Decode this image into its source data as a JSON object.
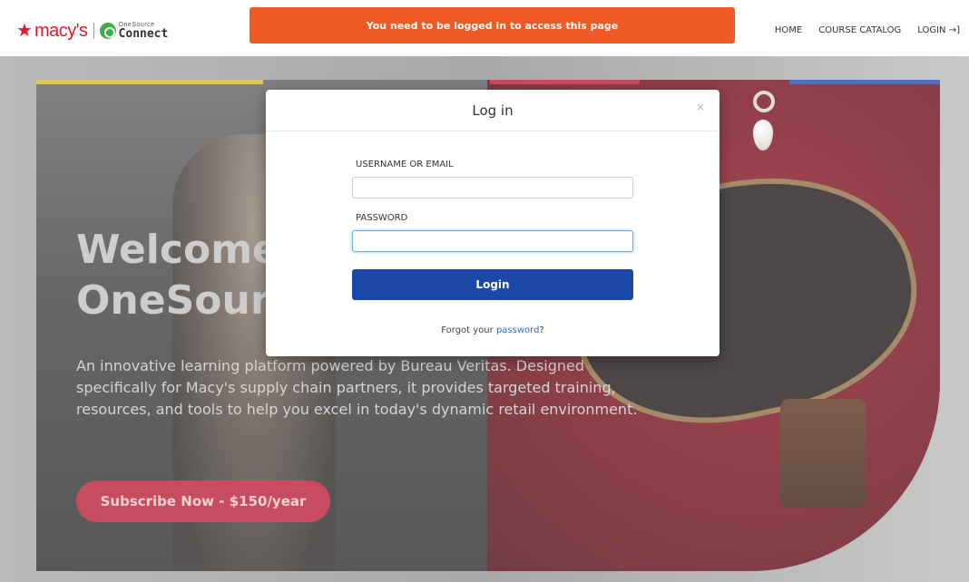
{
  "header": {
    "brand": "macy's",
    "partner_top": "OneSource",
    "partner_bottom": "Connect",
    "nav": [
      "HOME",
      "COURSE CATALOG",
      "LOGIN"
    ],
    "login_icon": "→]"
  },
  "alert": {
    "message": "You need to be logged in to access this page"
  },
  "hero": {
    "title_line1": "Welcome",
    "title_line2": "OneSour",
    "description": "An innovative learning platform powered by Bureau Veritas. Designed specifically for Macy's supply chain partners, it provides targeted training, resources, and tools to help you excel in today's dynamic retail environment.",
    "cta": "Subscribe Now - $150/year",
    "stripe_colors": [
      "#d8b52b",
      "#c21a2e",
      "#1f4aa8"
    ]
  },
  "modal": {
    "title": "Log in",
    "close_icon": "×",
    "username_label": "USERNAME OR EMAIL",
    "username_value": "",
    "password_label": "PASSWORD",
    "password_value": "",
    "login_button": "Login",
    "forgot_prefix": "Forgot your ",
    "forgot_link": "password",
    "forgot_suffix": "?"
  },
  "colors": {
    "alert": "#f05a24",
    "login_button": "#1a47a8",
    "cta": "#b81a33",
    "brand_red": "#e11a2b"
  }
}
